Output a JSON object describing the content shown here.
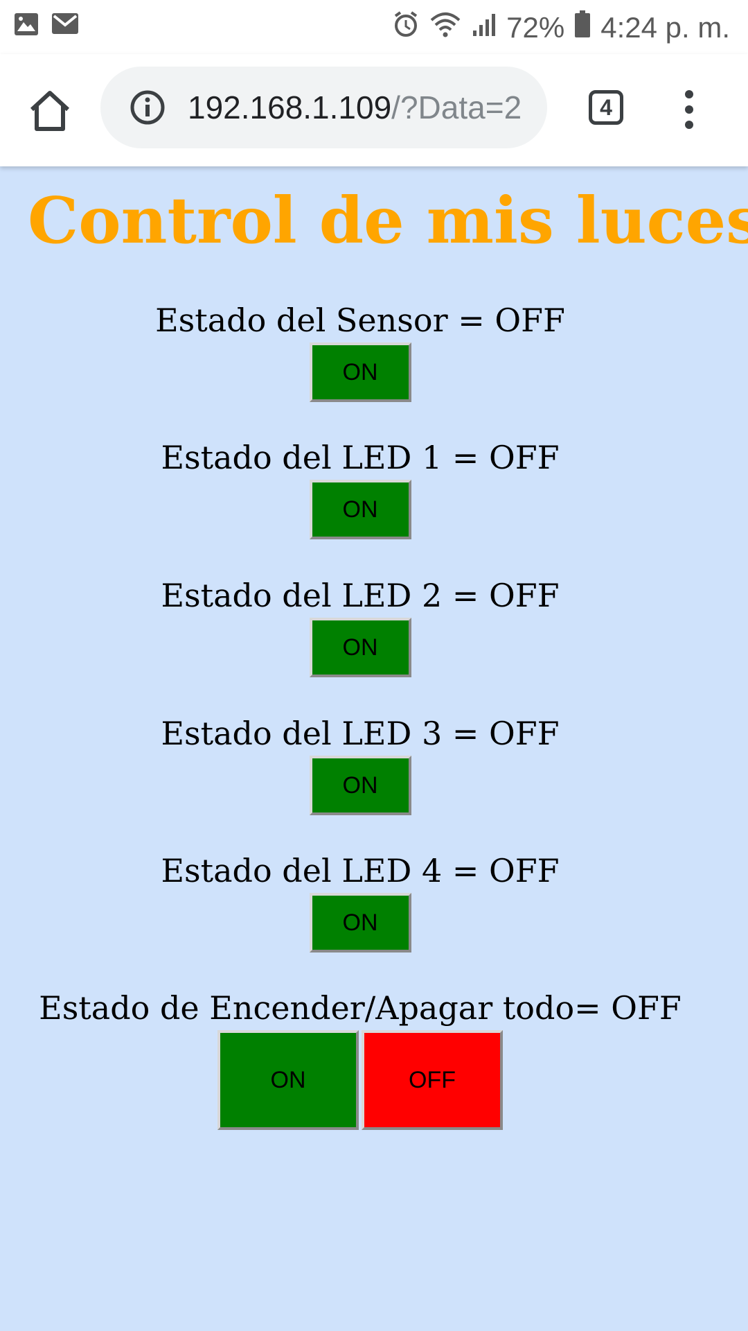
{
  "status_bar": {
    "battery": "72%",
    "time": "4:24 p. m."
  },
  "browser": {
    "url_host": "192.168.1.109",
    "url_path": "/?Data=2",
    "tab_count": "4"
  },
  "page": {
    "title": "Control de mis luces",
    "controls": [
      {
        "label": "Estado del Sensor = OFF",
        "on_label": "ON"
      },
      {
        "label": "Estado del LED 1 = OFF",
        "on_label": "ON"
      },
      {
        "label": "Estado del LED 2 = OFF",
        "on_label": "ON"
      },
      {
        "label": "Estado del LED 3 = OFF",
        "on_label": "ON"
      },
      {
        "label": "Estado del LED 4 = OFF",
        "on_label": "ON"
      }
    ],
    "all_control": {
      "label": "Estado de Encender/Apagar todo= OFF",
      "on_label": "ON",
      "off_label": "OFF"
    }
  },
  "colors": {
    "page_background": "#cfe2fb",
    "title": "#ffa500",
    "on_button": "#008000",
    "off_button": "#ff0000"
  }
}
